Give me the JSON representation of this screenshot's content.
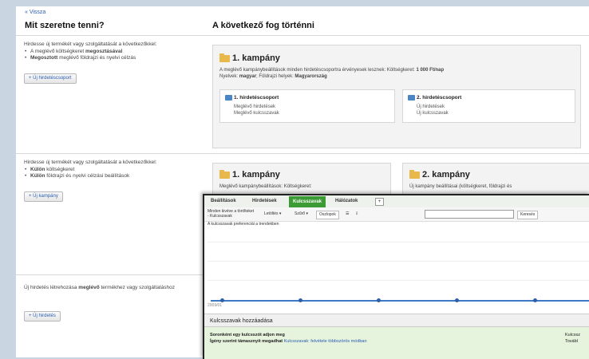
{
  "back_link": "« Vissza",
  "left_heading": "Mit szeretne tenni?",
  "right_heading": "A következő fog történni",
  "section1": {
    "desc_lead": "Hirdesse új termékét vagy szolgáltatását a következőkkel:",
    "bullet1_pre": "A meglévő költségkeret ",
    "bullet1_bold": "megosztásával",
    "bullet2_bold": "Megosztott",
    "bullet2_post": " meglévő földrajzi és nyelvi célzás",
    "button": "+ Új hirdetéscsoport",
    "campaign_title": "1. kampány",
    "campaign_desc_1": "A meglévő kampánybeállítások minden hirdetéscsoportra érvényesek lesznek: Költségkeret: ",
    "campaign_desc_budget": "1 000 Ft/nap",
    "campaign_desc_2": "Nyelvek: ",
    "campaign_desc_lang": "magyar",
    "campaign_desc_3": "; Földrajzi helyek: ",
    "campaign_desc_geo": "Magyarország",
    "group1": {
      "title": "1. hirdetéscsoport",
      "line1": "Meglévő hirdetések",
      "line2": "Meglévő kulcsszavak"
    },
    "group2": {
      "title": "2. hirdetéscsoport",
      "line1": "Új hirdetések",
      "line2": "Új kulcsszavak"
    }
  },
  "section2": {
    "desc_lead": "Hirdesse új termékét vagy szolgáltatását a következőkkel:",
    "bullet1_bold": "Külön",
    "bullet1_post": " költségkeret",
    "bullet2_bold": "Külön",
    "bullet2_post": " földrajzi és nyelvi célzási beállítások",
    "button": "+ Új kampány",
    "camp1_title": "1. kampány",
    "camp1_desc": "Meglévő kampánybeállítások: Költségkeret:",
    "camp2_title": "2. kampány",
    "camp2_desc": "Új kampány beállításai (költségkeret, földrajzi és"
  },
  "section3": {
    "desc_pre": "Új hirdetés létrehozása ",
    "desc_bold": "meglévő",
    "desc_post": " termékhez vagy szolgáltatáshoz",
    "button": "+ Új hirdetés"
  },
  "embedded": {
    "tabs": [
      "Beállítások",
      "Hirdetések",
      "Kulcsszavak",
      "Hálózatok"
    ],
    "active_tab": "Kulcsszavak",
    "tab_add": "+",
    "filter_label": "Minden kivéve a törölteket - Kulcsszavak",
    "toolbar_buttons": [
      "Letöltés ▾",
      "Szűrő ▾",
      "Oszlopok",
      "☰",
      "⇩"
    ],
    "search_button": "Keresés",
    "chart_caption": "A kulcsszavak preferenciái a trendekben",
    "axis_date": "2009/01",
    "add_section_title": "Kulcsszavak hozzáadása",
    "add_line1": "Soronként egy kulcsszót adjon meg",
    "add_line2_pre": "Ígény szerint támasznyit megadhat ",
    "add_line2_link": "Kulcsszavak: felvétele többszörös módban",
    "right_col_1": "Kulcssz",
    "right_col_2": "Továbl"
  }
}
